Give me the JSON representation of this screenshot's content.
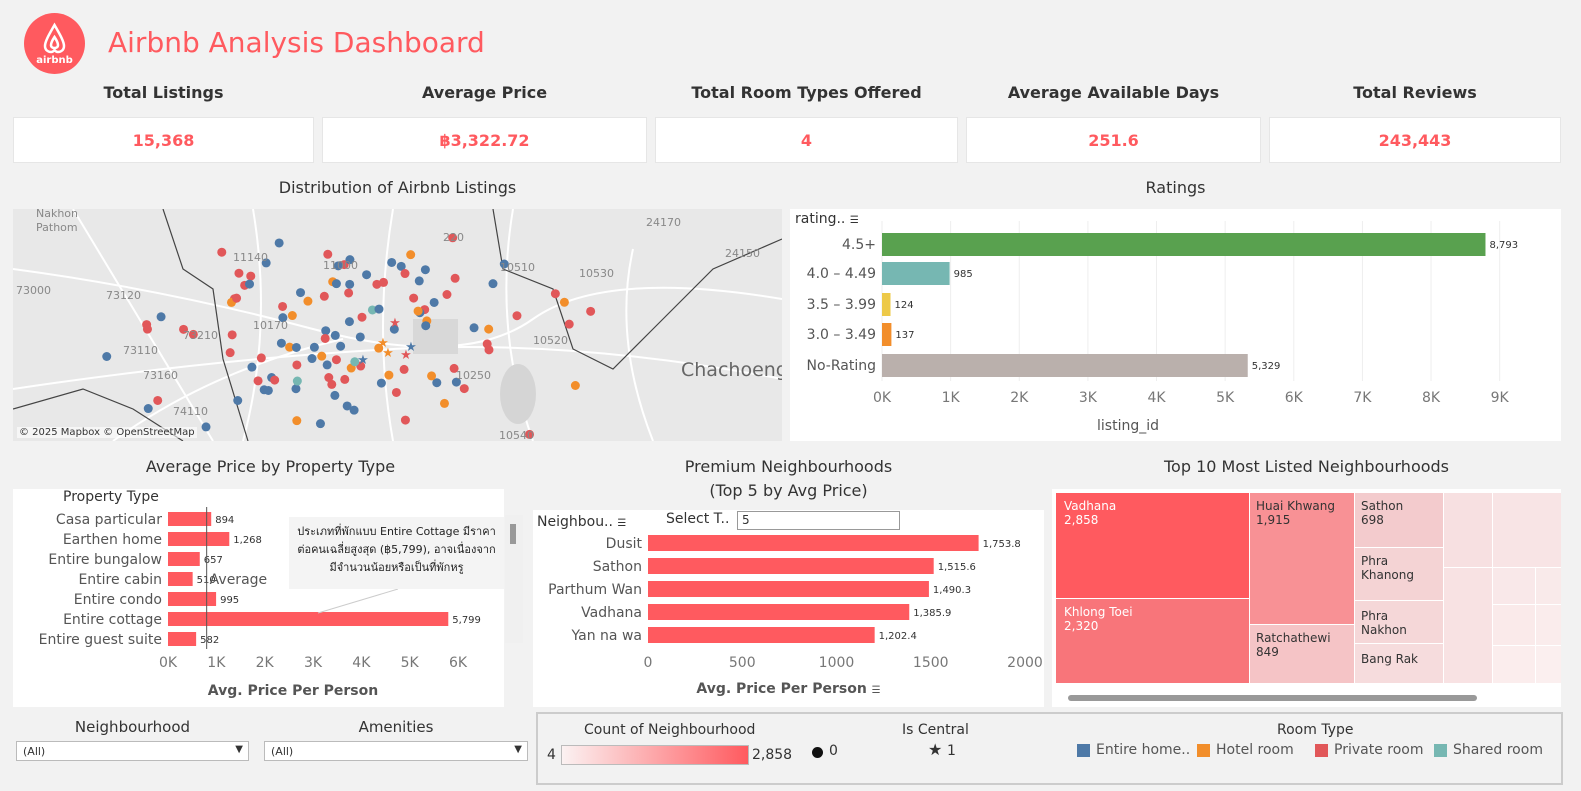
{
  "header": {
    "title": "Airbnb Analysis Dashboard",
    "logo_text": "airbnb",
    "brand_color": "#ff5a5f"
  },
  "kpis": [
    {
      "title": "Total Listings",
      "value": "15,368"
    },
    {
      "title": "Average Price",
      "value": "฿3,322.72"
    },
    {
      "title": "Total Room Types Offered",
      "value": "4"
    },
    {
      "title": "Average Available Days",
      "value": "251.6"
    },
    {
      "title": "Total Reviews",
      "value": "243,443"
    }
  ],
  "map": {
    "title": "Distribution of Airbnb Listings",
    "attribution": "© 2025 Mapbox © OpenStreetMap",
    "labels": [
      "Nakhon Pathom",
      "Chachoeng",
      "24170",
      "11140",
      "11000",
      "10510",
      "10530",
      "24150",
      "73120",
      "73000",
      "10170",
      "10520",
      "73110",
      "73160",
      "10250",
      "74110",
      "10540",
      "73210",
      "220"
    ]
  },
  "ratings": {
    "title": "Ratings",
    "header": "rating..",
    "chart_data": {
      "type": "bar",
      "orientation": "horizontal",
      "categories": [
        "4.5+",
        "4.0 – 4.49",
        "3.5 – 3.99",
        "3.0 – 3.49",
        "No-Rating"
      ],
      "values": [
        8793,
        985,
        124,
        137,
        5329
      ],
      "value_labels": [
        "8,793",
        "985",
        "124",
        "137",
        "5,329"
      ],
      "colors": [
        "#59a14f",
        "#76b7b2",
        "#edc948",
        "#f28e2b",
        "#bab0ac"
      ],
      "xlabel": "listing_id",
      "xlim": [
        0,
        9500
      ],
      "ticks": [
        "0K",
        "1K",
        "2K",
        "3K",
        "4K",
        "5K",
        "6K",
        "7K",
        "8K",
        "9K"
      ]
    }
  },
  "property": {
    "title": "Average Price by Property Type",
    "header": "Property Type",
    "tooltip": "ประเภทที่พักแบบ Entire Cottage มีราคาต่อคนเฉลี่ยสูงสุด (฿5,799), อาจเนื่องจากมีจำนวนน้อยหรือเป็นที่พักหรู",
    "ref_label": "Average",
    "chart_data": {
      "type": "bar",
      "orientation": "horizontal",
      "categories": [
        "Casa particular",
        "Earthen home",
        "Entire bungalow",
        "Entire cabin",
        "Entire condo",
        "Entire cottage",
        "Entire guest suite"
      ],
      "values": [
        894,
        1268,
        657,
        510,
        995,
        5799,
        582
      ],
      "value_labels": [
        "894",
        "1,268",
        "657",
        "510",
        "995",
        "5,799",
        "582"
      ],
      "xlabel": "Avg. Price Per Person",
      "xlim": [
        0,
        6600
      ],
      "ticks": [
        "0K",
        "1K",
        "2K",
        "3K",
        "4K",
        "5K",
        "6K"
      ],
      "reference_line": 800
    }
  },
  "premium": {
    "title_line1": "Premium Neighbourhoods",
    "title_line2": "(Top 5 by Avg Price)",
    "header": "Neighbou..",
    "select_label": "Select T..",
    "select_value": "5",
    "chart_data": {
      "type": "bar",
      "orientation": "horizontal",
      "categories": [
        "Dusit",
        "Sathon",
        "Parthum Wan",
        "Vadhana",
        "Yan na wa"
      ],
      "values": [
        1753.8,
        1515.6,
        1490.3,
        1385.9,
        1202.4
      ],
      "value_labels": [
        "1,753.8",
        "1,515.6",
        "1,490.3",
        "1,385.9",
        "1,202.4"
      ],
      "xlabel": "Avg. Price Per Person",
      "xlim": [
        0,
        2000
      ],
      "ticks": [
        "0",
        "500",
        "1000",
        "1500",
        "2000"
      ]
    }
  },
  "treemap": {
    "title": "Top 10 Most Listed Neighbourhoods",
    "cells": [
      {
        "name": "Vadhana",
        "value": "2,858"
      },
      {
        "name": "Khlong Toei",
        "value": "2,320"
      },
      {
        "name": "Huai Khwang",
        "value": "1,915"
      },
      {
        "name": "Ratchathewi",
        "value": "849"
      },
      {
        "name": "Sathon",
        "value": "698"
      },
      {
        "name": "Phra Khanong",
        "value": ""
      },
      {
        "name": "Phra Nakhon",
        "value": ""
      },
      {
        "name": "Bang Rak",
        "value": ""
      }
    ]
  },
  "filters": {
    "neighbourhood_label": "Neighbourhood",
    "neighbourhood_value": "(All)",
    "amenities_label": "Amenities",
    "amenities_value": "(All)"
  },
  "legends": {
    "count_title": "Count of Neighbourhood",
    "count_min": "4",
    "count_max": "2,858",
    "central_title": "Is Central",
    "central_0": "0",
    "central_1": "1",
    "room_title": "Room Type",
    "room_types": [
      {
        "label": "Entire home..",
        "color": "#4e79a7"
      },
      {
        "label": "Hotel room",
        "color": "#f28e2b"
      },
      {
        "label": "Private room",
        "color": "#e15759"
      },
      {
        "label": "Shared room",
        "color": "#76b7b2"
      }
    ]
  }
}
